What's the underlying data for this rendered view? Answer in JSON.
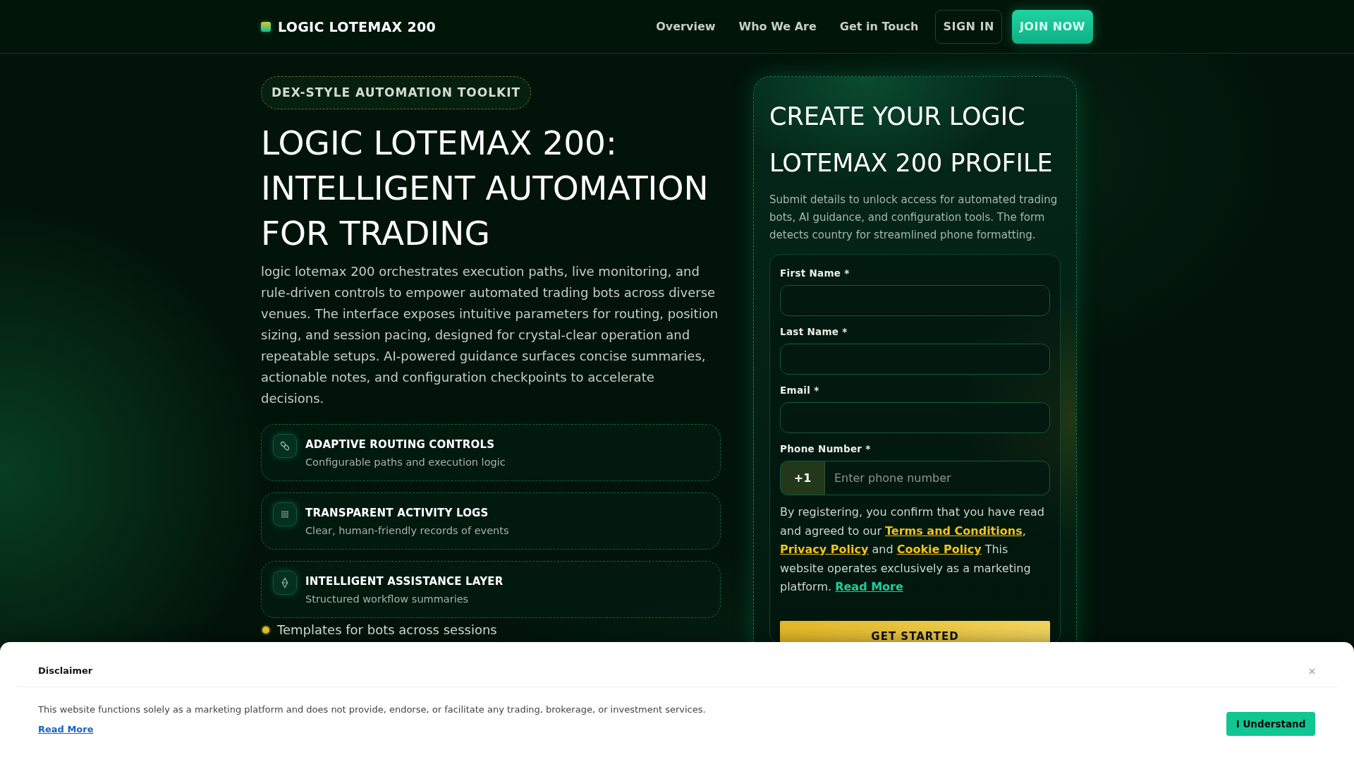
{
  "header": {
    "logo": "LOGIC LOTEMAX 200",
    "nav": [
      "Overview",
      "Who We Are",
      "Get in Touch"
    ],
    "sign_in": "SIGN IN",
    "join_now": "JOIN NOW"
  },
  "hero": {
    "badge": "DEX-STYLE AUTOMATION TOOLKIT",
    "title": "LOGIC LOTEMAX 200: INTELLIGENT AUTOMATION FOR TRADING",
    "description": "logic lotemax 200 orchestrates execution paths, live monitoring, and rule-driven controls to empower automated trading bots across diverse venues. The interface exposes intuitive parameters for routing, position sizing, and session pacing, designed for crystal-clear operation and repeatable setups. AI-powered guidance surfaces concise summaries, actionable notes, and configuration checkpoints to accelerate decisions.",
    "features": [
      {
        "title": "ADAPTIVE ROUTING CONTROLS",
        "subtitle": "Configurable paths and execution logic"
      },
      {
        "title": "TRANSPARENT ACTIVITY LOGS",
        "subtitle": "Clear, human-friendly records of events"
      },
      {
        "title": "INTELLIGENT ASSISTANCE LAYER",
        "subtitle": "Structured workflow summaries"
      }
    ],
    "bullets": [
      "Templates for bots across sessions"
    ]
  },
  "signup": {
    "title": "CREATE YOUR LOGIC LOTEMAX 200 PROFILE",
    "description": "Submit details to unlock access for automated trading bots, AI guidance, and configuration tools. The form detects country for streamlined phone formatting.",
    "fields": [
      {
        "kind": "text",
        "label": "First Name *"
      },
      {
        "kind": "text",
        "label": "Last Name *"
      },
      {
        "kind": "text",
        "label": "Email *"
      },
      {
        "kind": "phone",
        "label": "Phone Number *",
        "prefix": "+1",
        "placeholder": "Enter phone number"
      }
    ],
    "consent": {
      "lead": "By registering, you confirm that you have read and agreed to our",
      "terms_link": "Terms and Conditions",
      "separator": ",",
      "privacy_link": "Privacy Policy",
      "joiner": "and",
      "cookie_link": "Cookie Policy",
      "notice": "This website operates exclusively as a marketing platform.",
      "read_more_link": "Read More"
    },
    "submit": "GET STARTED"
  },
  "disclaimer": {
    "title": "Disclaimer",
    "text": "This website functions solely as a marketing platform and does not provide, endorse, or facilitate any trading, brokerage, or investment services.",
    "link": "Read More",
    "button": "I Understand"
  }
}
